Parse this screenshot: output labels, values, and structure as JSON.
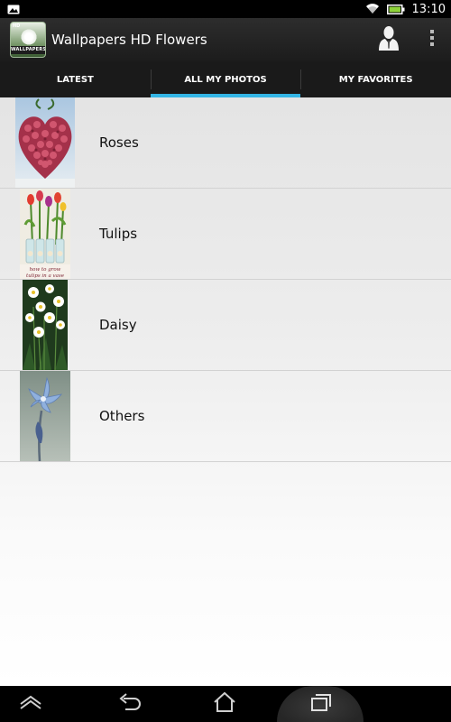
{
  "status_bar": {
    "time": "13:10",
    "icons": [
      "picture-icon",
      "wifi-icon",
      "battery-icon"
    ]
  },
  "action_bar": {
    "app_icon": {
      "badge": "HD",
      "ribbon_text": "WALLPAPERS"
    },
    "title": "Wallpapers HD Flowers",
    "buttons": [
      "person-icon",
      "overflow-menu-icon"
    ]
  },
  "tabs": [
    {
      "label": "LATEST",
      "active": false
    },
    {
      "label": "ALL MY PHOTOS",
      "active": true
    },
    {
      "label": "MY FAVORITES",
      "active": false
    }
  ],
  "accent_color": "#33b5e5",
  "categories": [
    {
      "label": "Roses",
      "thumbnail": "rose-heart-image"
    },
    {
      "label": "Tulips",
      "thumbnail": "tulips-vase-image",
      "thumbnail_caption": "how to grow tulips in a vase"
    },
    {
      "label": "Daisy",
      "thumbnail": "daisy-image"
    },
    {
      "label": "Others",
      "thumbnail": "blue-flower-image"
    }
  ],
  "nav_bar": {
    "buttons": [
      "home-up-icon",
      "back-icon",
      "home-icon",
      "recent-apps-icon"
    ]
  }
}
